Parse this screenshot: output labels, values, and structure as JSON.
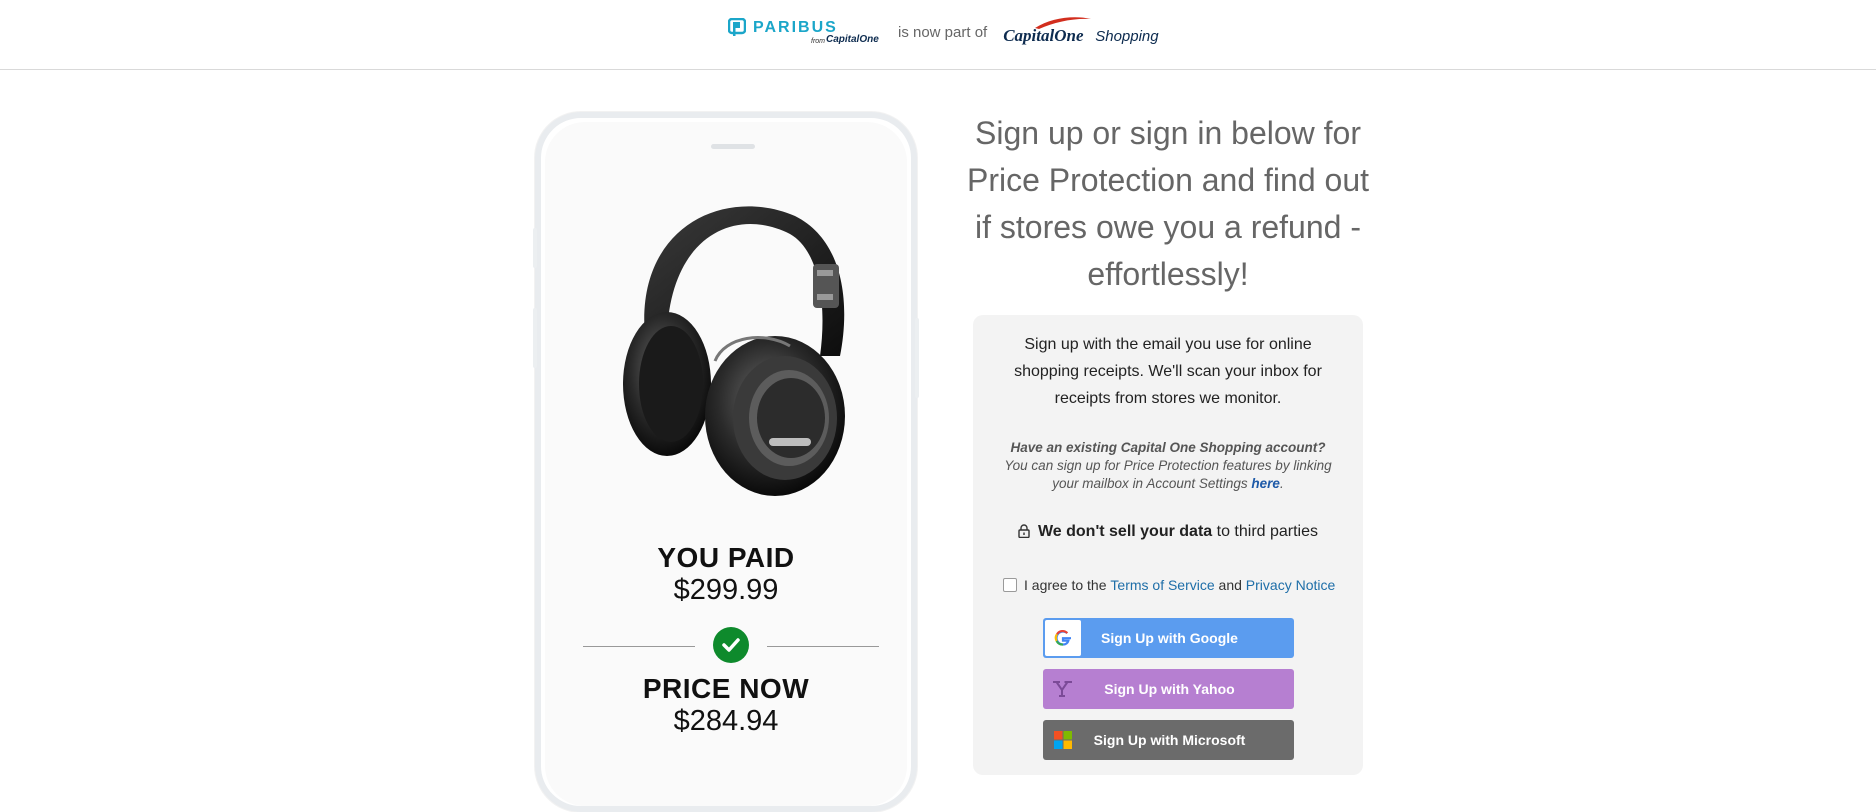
{
  "header": {
    "paribus_name": "PARIBUS",
    "paribus_from": "from",
    "paribus_capitalone": "CapitalOne",
    "connector": "is now part of",
    "capitalone_word": "CapitalOne",
    "shopping_word": "Shopping",
    "brand_color": "#1ba6c9",
    "capitalone_navy": "#0d2b4f",
    "capitalone_red": "#d22e1e"
  },
  "phone": {
    "you_paid_label": "YOU PAID",
    "you_paid_value": "$299.99",
    "price_now_label": "PRICE NOW",
    "price_now_value": "$284.94",
    "check_color": "#0e8a2c",
    "product_icon": "headphones-image"
  },
  "signup": {
    "headline": "Sign up or sign in below for Price Protection and find out if stores owe you a refund - effortlessly!",
    "intro": "Sign up with the email you use for online shopping receipts. We'll scan your inbox for receipts from stores we monitor.",
    "existing_question": "Have an existing Capital One Shopping account?",
    "existing_text": "You can sign up for Price Protection features by linking your mailbox in Account Settings",
    "existing_link": "here",
    "existing_period": ".",
    "privacy_bold": "We don't sell your data",
    "privacy_rest": "to third parties",
    "agree_prefix": "I agree to the",
    "terms_link": "Terms of Service",
    "agree_and": "and",
    "privacy_link": "Privacy Notice",
    "buttons": {
      "google": "Sign Up with Google",
      "yahoo": "Sign Up with Yahoo",
      "microsoft": "Sign Up with Microsoft"
    },
    "colors": {
      "google": "#5b9cef",
      "yahoo": "#b67fd1",
      "microsoft": "#6b6b6b",
      "link": "#1e6ea8"
    }
  }
}
